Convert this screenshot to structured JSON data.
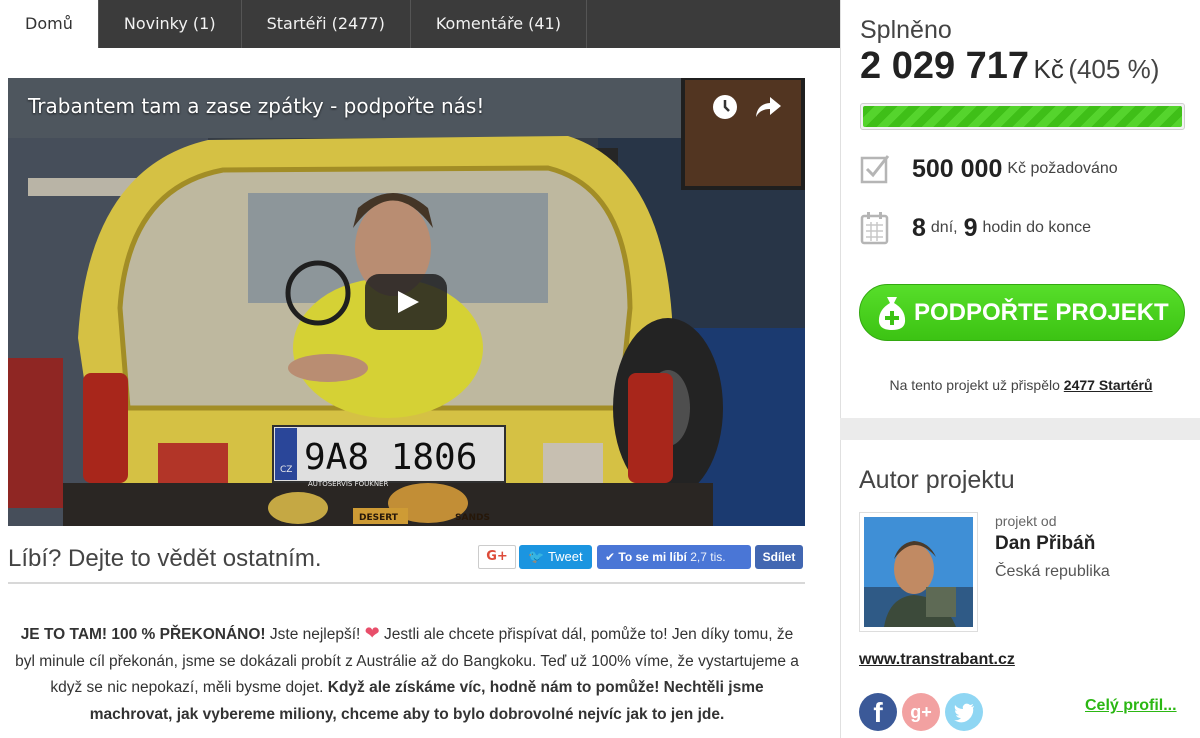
{
  "tabs": [
    {
      "label": "Domů"
    },
    {
      "label": "Novinky (1)"
    },
    {
      "label": "Startéři (2477)"
    },
    {
      "label": "Komentáře (41)"
    }
  ],
  "video": {
    "title": "Trabantem tam a zase zpátky - podpořte nás!",
    "license_plate": "9A8 1806",
    "plate_country": "CZ",
    "plate_dealer": "AUTOSERVIS FOUKNER",
    "sticker_left": "DESERT",
    "sticker_right": "SANDS"
  },
  "share": {
    "title": "Líbí? Dejte to vědět ostatním.",
    "gplus_label": "G+",
    "tweet_label": "Tweet",
    "like_label": "To se mi líbí",
    "like_count": "2,7 tis.",
    "share_label": "Sdílet"
  },
  "description": {
    "p1_bold1": "JE TO TAM! 100 % PŘEKONÁNO!",
    "p1_text1": " Jste nejlepší! ",
    "p1_text2": " Jestli ale chcete přispívat dál, pomůže to! Jen díky tomu, že byl minule cíl překonán, jsme se dokázali probít z Austrálie až do Bangkoku. Teď už 100% víme, že vystartujeme a když se nic nepokazí, měli bysme dojet. ",
    "p1_bold2": "Když ale získáme víc, hodně nám to pomůže! Nechtěli jsme machrovat, jak vybereme miliony, chceme aby to bylo dobrovolné nejvíc jak to jen jde."
  },
  "funding": {
    "label": "Splněno",
    "amount": "2 029 717",
    "currency": "Kč",
    "percent": "(405 %)",
    "progress_fraction": 1.0,
    "goal": "500 000",
    "goal_suffix": "Kč požadováno",
    "days": "8",
    "days_label": "dní,",
    "hours": "9",
    "hours_label": "hodin do konce",
    "support_button": "PODPOŘTE PROJEKT",
    "contrib_text": "Na tento projekt už přispělo",
    "contrib_link": "2477 Startérů"
  },
  "author": {
    "title": "Autor projektu",
    "project_by": "projekt od",
    "name": "Dan Přibáň",
    "country": "Česká republika",
    "website": "www.transtrabant.cz",
    "facebook_glyph": "f",
    "gplus_glyph": "g+",
    "profile_link": "Celý profil..."
  },
  "colors": {
    "accent_green": "#3cc313",
    "tab_bar": "#3b3b3b",
    "trabant_yellow": "#e8d24a"
  },
  "icons": {
    "clock": "clock-icon",
    "share": "share-arrow-icon",
    "play": "play-icon",
    "goal": "checkbox-icon",
    "calendar": "calendar-icon",
    "support": "money-bag-icon",
    "facebook": "facebook-icon",
    "gplus": "google-plus-icon",
    "twitter": "twitter-icon",
    "like": "thumbs-up-icon"
  }
}
